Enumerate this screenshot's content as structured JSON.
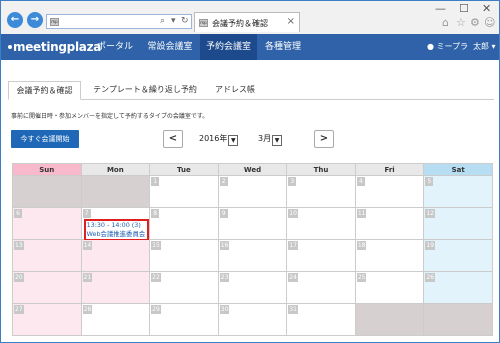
{
  "browser": {
    "window_controls": {
      "minimize": "—",
      "maximize": "☐",
      "close": "✕"
    },
    "back_icon": "←",
    "forward_icon": "→",
    "address_favicon": "mp",
    "search_icon": "⌕",
    "dropdown_icon": "▾",
    "refresh_icon": "↻",
    "tab_title": "会議予約＆確認",
    "tab_close": "×",
    "home_icon": "⌂",
    "star_icon": "☆",
    "settings_icon": "⚙",
    "smiley_icon": "☺"
  },
  "app": {
    "logo": "meetingplaza",
    "menu": [
      "ポータル",
      "常設会議室",
      "予約会議室",
      "各種管理"
    ],
    "active_menu": "予約会議室",
    "user_name": "ミープラ",
    "user_menu": "太郎 ▾"
  },
  "subtabs": [
    "会議予約＆確認",
    "テンプレート＆繰り返し予約",
    "アドレス帳"
  ],
  "description": "事前に開催日時・参加メンバーを指定して予約するタイプの会議室です。",
  "controls": {
    "start_button": "今すぐ会議開始",
    "prev": "<",
    "next": ">",
    "year": "2016年",
    "month": "3月"
  },
  "calendar": {
    "headers": [
      "Sun",
      "Mon",
      "Tue",
      "Wed",
      "Thu",
      "Fri",
      "Sat"
    ],
    "weeks": [
      [
        "",
        "",
        "1",
        "2",
        "3",
        "4",
        "5"
      ],
      [
        "6",
        "7",
        "8",
        "9",
        "10",
        "11",
        "12"
      ],
      [
        "13",
        "14",
        "15",
        "16",
        "17",
        "18",
        "19"
      ],
      [
        "20",
        "21",
        "22",
        "23",
        "24",
        "25",
        "26"
      ],
      [
        "27",
        "28",
        "29",
        "30",
        "31",
        "",
        ""
      ]
    ],
    "event": {
      "time": "13:30 - 14:00 (3)",
      "title": "Web会議推進委員会"
    }
  },
  "colors": {
    "appbar": "#2f62a8",
    "active_menu": "#1c4a8c",
    "start_button": "#1f68b8",
    "sunday_header": "#f8b9cd",
    "saturday_header": "#b7ddf3",
    "event_border": "#e02020"
  }
}
